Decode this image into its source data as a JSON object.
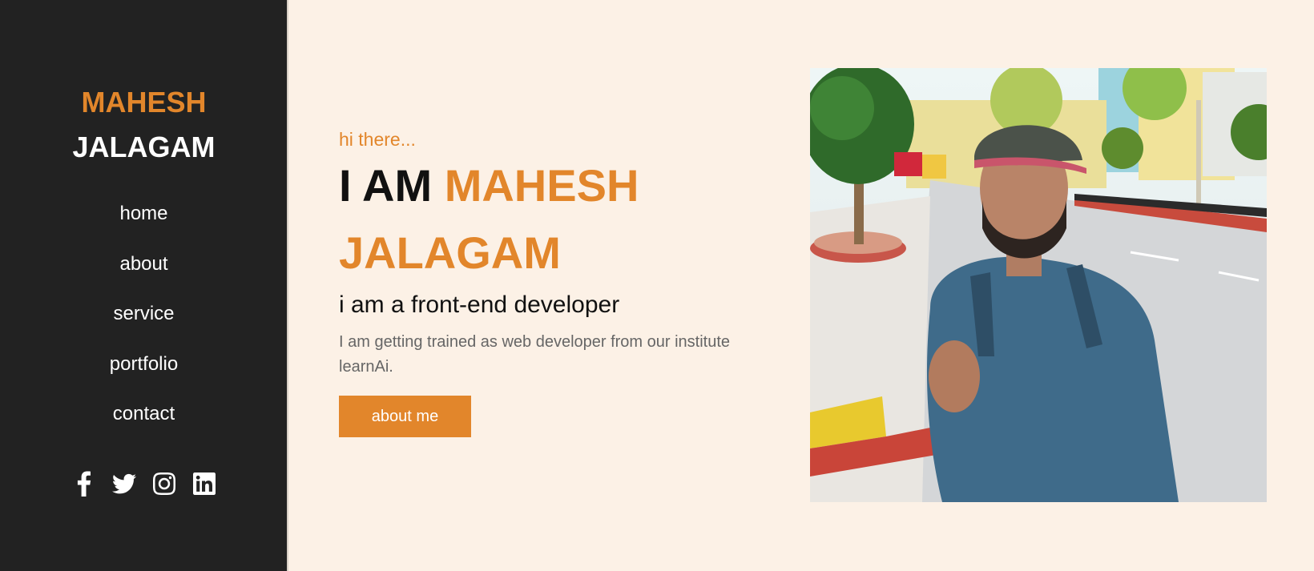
{
  "sidebar": {
    "brand_first": "MAHESH",
    "brand_last": "JALAGAM",
    "nav": [
      "home",
      "about",
      "service",
      "portfolio",
      "contact"
    ],
    "social": [
      "facebook-icon",
      "twitter-icon",
      "instagram-icon",
      "linkedin-icon"
    ]
  },
  "hero": {
    "greeting": "hi there...",
    "headline_prefix": "I AM",
    "headline_name_1": "MAHESH",
    "headline_name_2": "JALAGAM",
    "role": "i am a front-end developer",
    "description": "I am getting trained as web developer from our institute learnAi.",
    "button": "about me"
  },
  "colors": {
    "accent": "#e2862b",
    "sidebar_bg": "#222222",
    "page_bg": "#fcf1e6"
  }
}
